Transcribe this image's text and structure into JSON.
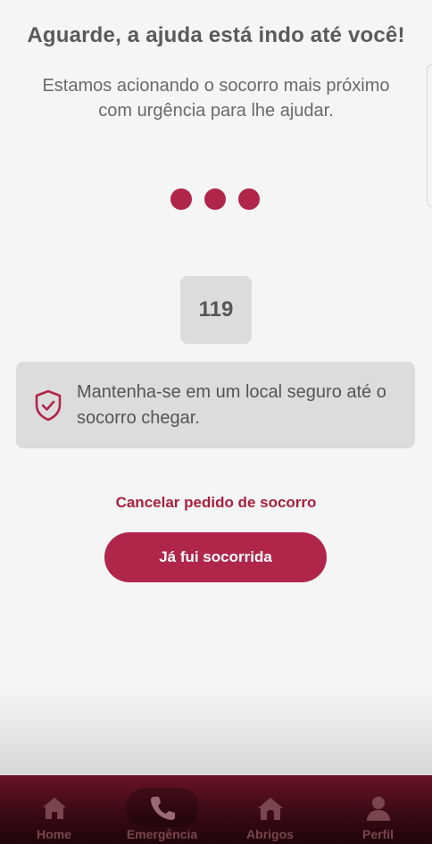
{
  "header": {
    "title": "Aguarde, a ajuda está indo até você!",
    "subtitle": "Estamos acionando o socorro mais próximo com urgência para lhe ajudar."
  },
  "emergency": {
    "number": "119"
  },
  "safety_card": {
    "icon": "shield-check-icon",
    "message": "Mantenha-se em um local seguro até o socorro chegar."
  },
  "actions": {
    "cancel_label": "Cancelar pedido de socorro",
    "rescued_label": "Já fui socorrida"
  },
  "nav": {
    "items": [
      {
        "label": "Home",
        "icon": "home-icon"
      },
      {
        "label": "Emergência",
        "icon": "phone-icon",
        "active": true
      },
      {
        "label": "Abrigos",
        "icon": "shelter-icon"
      },
      {
        "label": "Perfil",
        "icon": "user-icon"
      }
    ]
  },
  "colors": {
    "accent": "#b0264b",
    "text_muted": "#6a6a6a",
    "nav_bg": "#3a0a16"
  }
}
